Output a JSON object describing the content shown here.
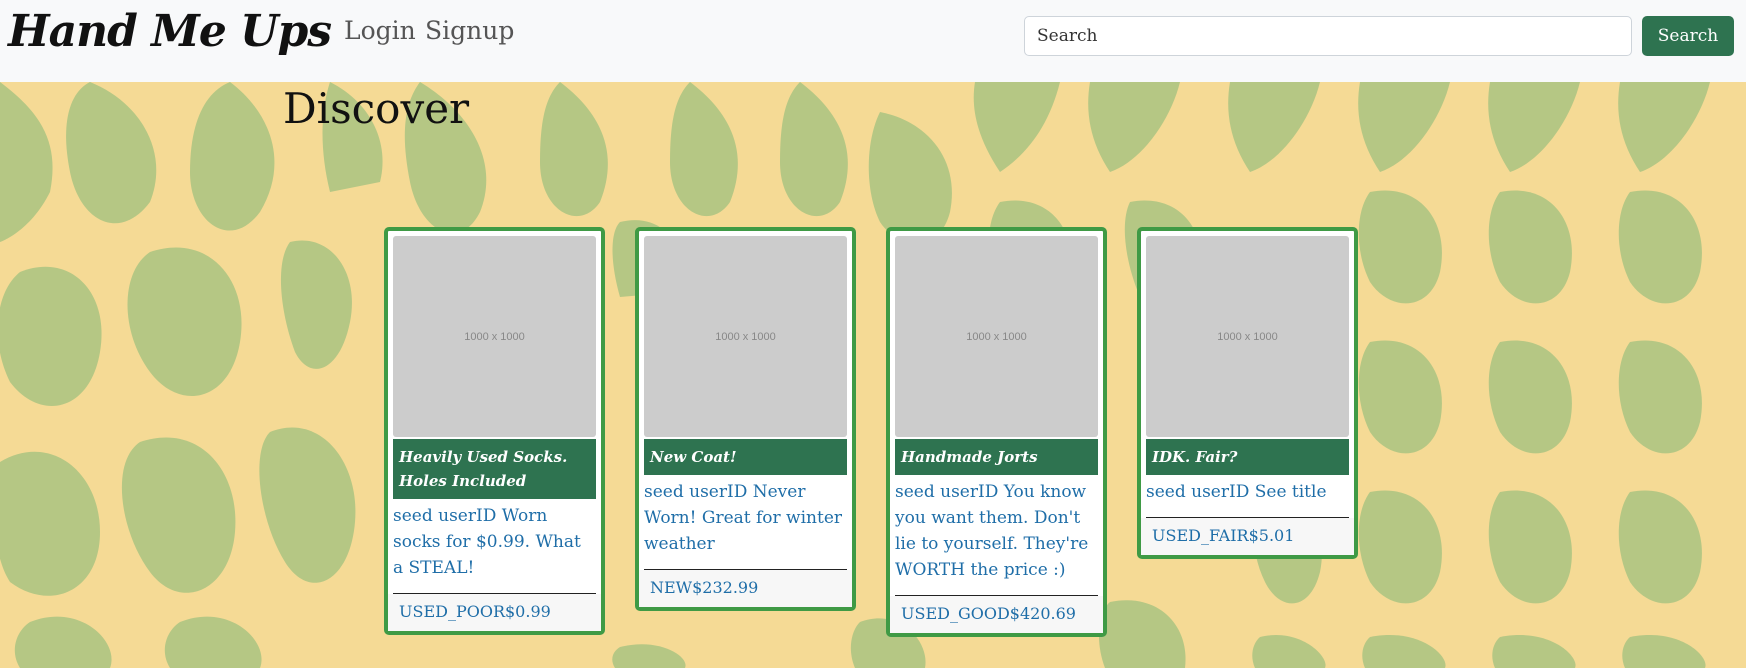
{
  "brand": "Hand Me Ups",
  "nav": {
    "login": "Login",
    "signup": "Signup"
  },
  "search": {
    "placeholder": "Search",
    "button": "Search"
  },
  "page_title": "Discover",
  "colors": {
    "navbar_bg": "#f8f9fa",
    "button": "#2e7350",
    "card_border": "#3f9a45",
    "link_text": "#1f6ea8",
    "bg_yellow": "#f5da95",
    "bg_green": "#b5c784"
  },
  "listings": [
    {
      "image_text": "1000 x 1000",
      "title": "Heavily Used Socks. Holes Included",
      "description": "seed userID Worn socks for $0.99. What a STEAL!",
      "condition": "USED_POOR",
      "price": "$0.99"
    },
    {
      "image_text": "1000 x 1000",
      "title": "New Coat!",
      "description": "seed userID Never Worn! Great for winter weather",
      "condition": "NEW",
      "price": "$232.99"
    },
    {
      "image_text": "1000 x 1000",
      "title": "Handmade Jorts",
      "description": "seed userID You know you want them. Don't lie to yourself. They're WORTH the price :)",
      "condition": "USED_GOOD",
      "price": "$420.69"
    },
    {
      "image_text": "1000 x 1000",
      "title": "IDK. Fair?",
      "description": "seed userID See title",
      "condition": "USED_FAIR",
      "price": "$5.01"
    }
  ]
}
